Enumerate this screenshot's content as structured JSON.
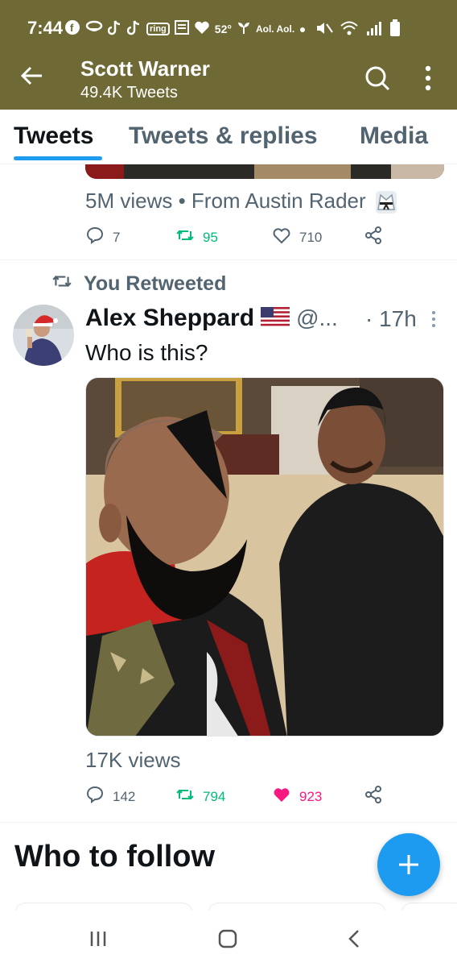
{
  "status_bar": {
    "time": "7:44",
    "temperature": "52°",
    "carrier_text": "Aol. Aol.",
    "ring_label": "ring"
  },
  "header": {
    "title": "Scott Warner",
    "subtitle": "49.4K Tweets",
    "background_color": "#6e6935"
  },
  "tabs": [
    {
      "label": "Tweets",
      "active": true
    },
    {
      "label": "Tweets & replies",
      "active": false
    },
    {
      "label": "Media",
      "active": false
    }
  ],
  "prev_tweet": {
    "views_text": "5M views • From Austin Rader",
    "reply_count": "7",
    "retweet_count": "95",
    "like_count": "710"
  },
  "tweet": {
    "retweet_label": "You Retweeted",
    "author_name": "Alex Sheppard",
    "handle": "@...",
    "time": "· 17h",
    "text": "Who is this?",
    "views_text": "17K views",
    "reply_count": "142",
    "retweet_count": "794",
    "like_count": "923",
    "liked": true
  },
  "who_to_follow": {
    "title": "Who to follow"
  },
  "colors": {
    "accent": "#1d9bf0",
    "retweet_green": "#00ba7c",
    "like_pink": "#f91880",
    "muted": "#536471"
  },
  "icons": [
    "back-arrow-icon",
    "search-icon",
    "more-vertical-icon",
    "reply-icon",
    "retweet-icon",
    "heart-icon",
    "share-icon",
    "compose-plus-icon",
    "recents-icon",
    "home-icon",
    "nav-back-icon",
    "flag-us-icon",
    "karate-gi-icon"
  ]
}
